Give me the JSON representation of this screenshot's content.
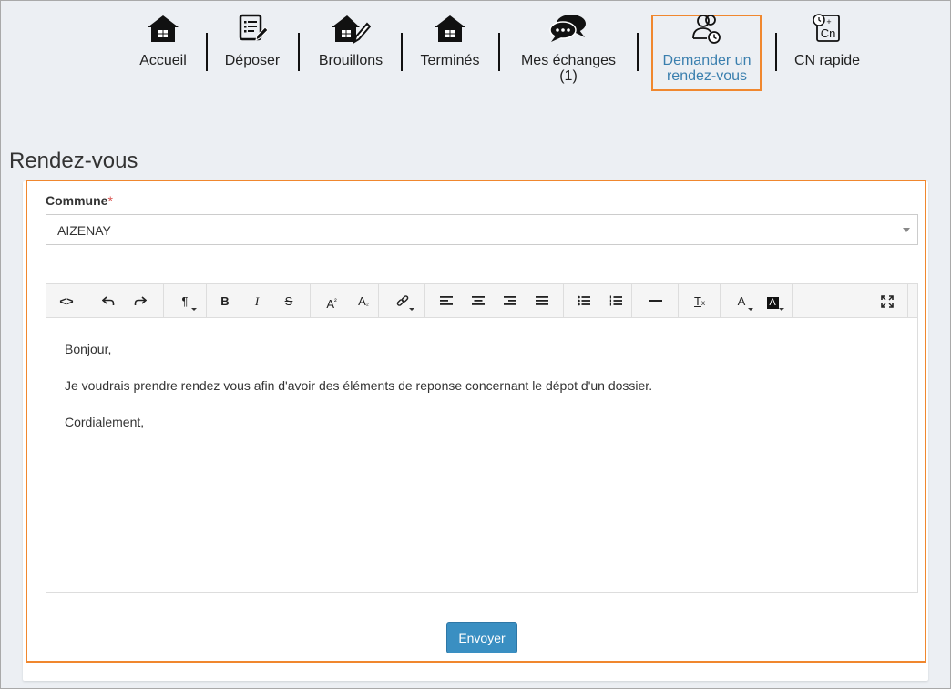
{
  "nav": {
    "items": [
      {
        "label": "Accueil",
        "icon": "home-icon"
      },
      {
        "label": "Déposer",
        "icon": "document-edit-icon"
      },
      {
        "label": "Brouillons",
        "icon": "home-edit-icon"
      },
      {
        "label": "Terminés",
        "icon": "home-icon"
      },
      {
        "label": "Mes échanges",
        "label2": "(1)",
        "icon": "chat-bubbles-icon"
      },
      {
        "label": "Demander un",
        "label2": "rendez-vous",
        "icon": "users-clock-icon",
        "active": true
      },
      {
        "label": "CN rapide",
        "icon": "cn-calculator-icon"
      }
    ]
  },
  "page": {
    "title": "Rendez-vous"
  },
  "form": {
    "commune_label": "Commune",
    "required_mark": "*",
    "commune_value": "AIZENAY",
    "message_lines": [
      "Bonjour,",
      "Je voudrais prendre rendez vous afin d'avoir des éléments de reponse concernant le dépot d'un dossier.",
      "Cordialement,"
    ],
    "submit_label": "Envoyer"
  },
  "toolbar": {
    "source": "<>",
    "paragraph": "¶",
    "bold": "B",
    "italic": "I",
    "strike": "S",
    "superscript": "A",
    "superscript_mark": "²",
    "subscript": "A",
    "subscript_mark": "₂",
    "clear_format": "T",
    "clear_format_mark": "x",
    "font_color": "A",
    "bg_color": "A"
  },
  "colors": {
    "accent": "#f0872e",
    "link_active": "#3a7fae",
    "primary_button": "#3a8fc2"
  }
}
